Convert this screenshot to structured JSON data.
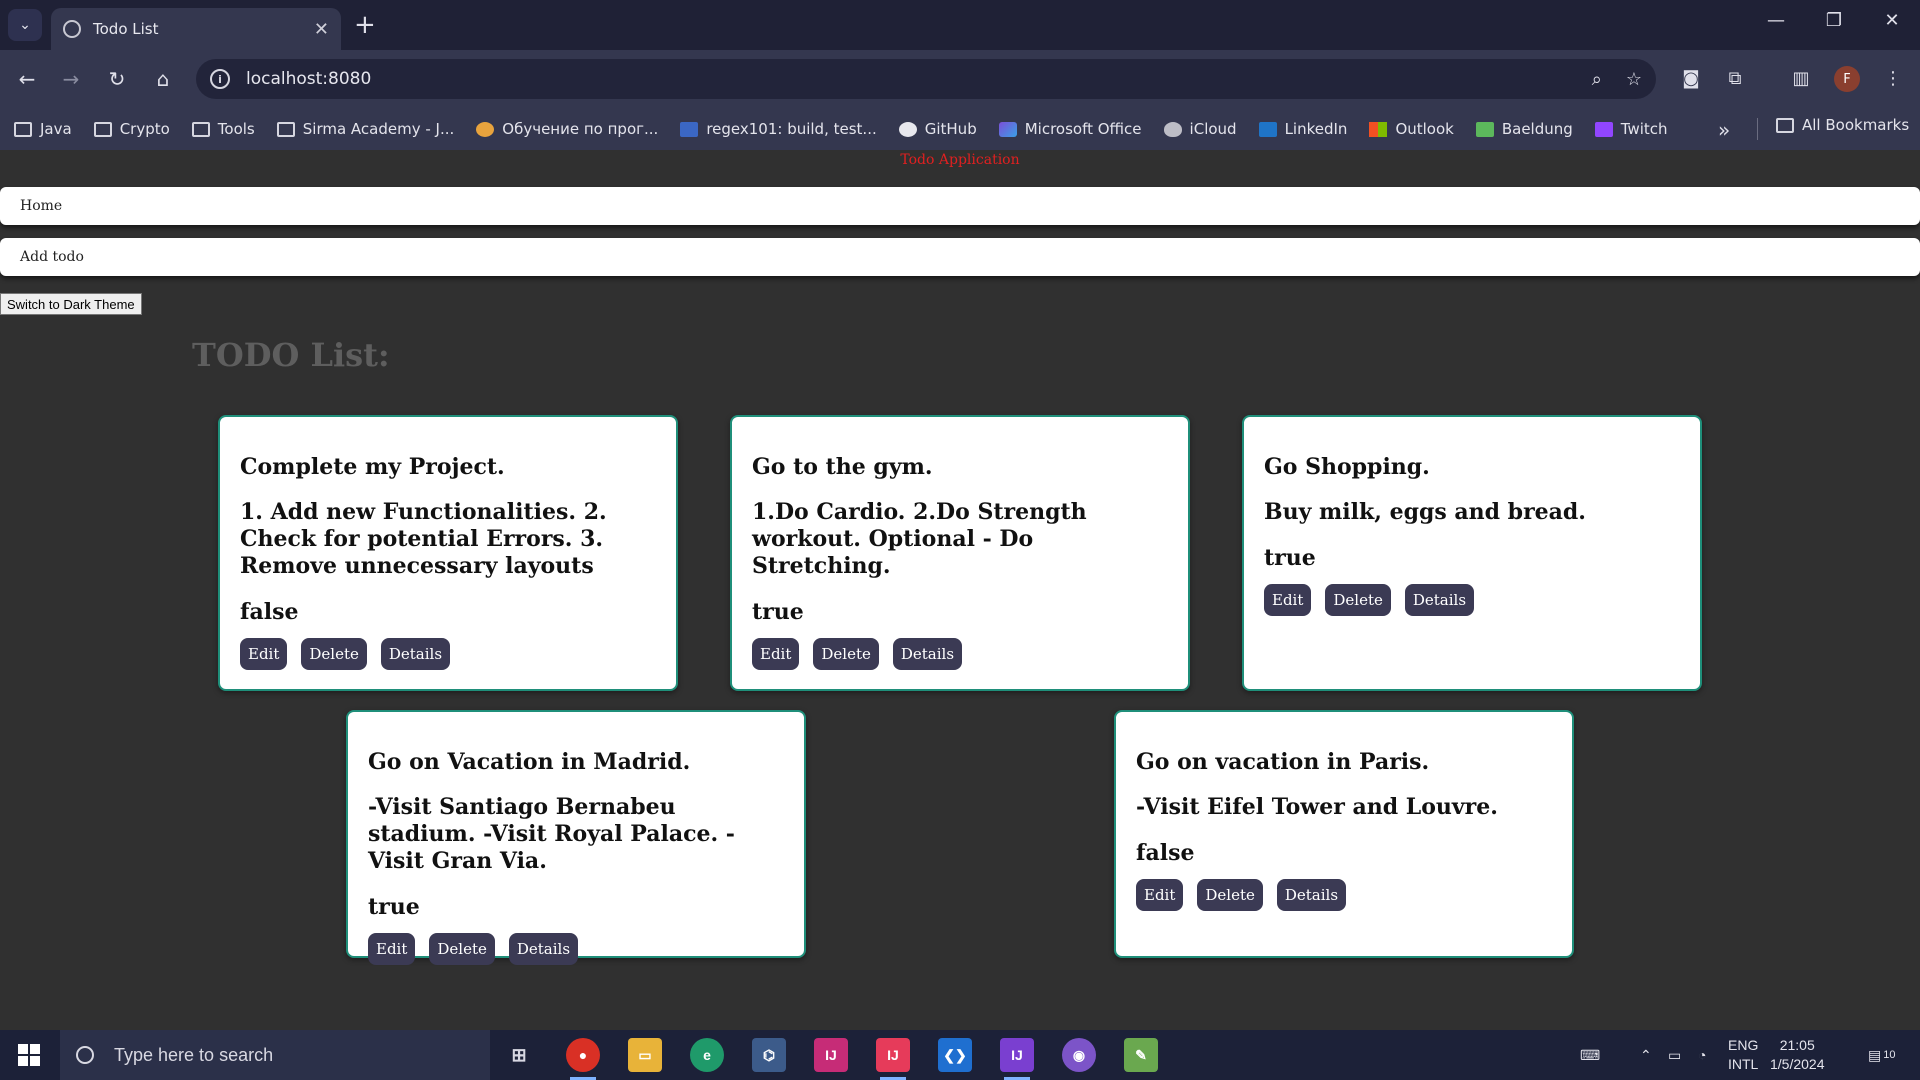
{
  "browser": {
    "tab_title": "Todo List",
    "url": "localhost:8080",
    "profile_initial": "F",
    "bookmarks": [
      {
        "label": "Java",
        "icon": "folder-icon"
      },
      {
        "label": "Crypto",
        "icon": "folder-icon"
      },
      {
        "label": "Tools",
        "icon": "folder-icon"
      },
      {
        "label": "Sirma Academy - J...",
        "icon": "folder-icon"
      },
      {
        "label": "Обучение по прог...",
        "icon": "softuni-icon"
      },
      {
        "label": "regex101: build, test...",
        "icon": "regex101-icon"
      },
      {
        "label": "GitHub",
        "icon": "github-icon"
      },
      {
        "label": "Microsoft Office",
        "icon": "office-icon"
      },
      {
        "label": "iCloud",
        "icon": "apple-icon"
      },
      {
        "label": "LinkedIn",
        "icon": "linkedin-icon"
      },
      {
        "label": "Outlook",
        "icon": "microsoft-icon"
      },
      {
        "label": "Baeldung",
        "icon": "baeldung-icon"
      },
      {
        "label": "Twitch",
        "icon": "twitch-icon"
      }
    ],
    "all_bookmarks_label": "All Bookmarks"
  },
  "page": {
    "app_title": "Todo Application",
    "nav": {
      "home": "Home",
      "add_todo": "Add todo"
    },
    "theme_button": "Switch to Dark Theme",
    "list_title": "TODO List:",
    "todos": [
      {
        "title": "Complete my Project.",
        "description": "1. Add new Functionalities. 2. Check for potential Errors. 3. Remove unnecessary layouts",
        "status": "false"
      },
      {
        "title": "Go to the gym.",
        "description": "1.Do Cardio. 2.Do Strength workout. Optional - Do Stretching.",
        "status": "true"
      },
      {
        "title": "Go Shopping.",
        "description": "Buy milk, eggs and bread.",
        "status": "true"
      },
      {
        "title": "Go on Vacation in Madrid.",
        "description": "-Visit Santiago Bernabeu stadium. -Visit Royal Palace. -Visit Gran Via.",
        "status": "true"
      },
      {
        "title": "Go on vacation in Paris.",
        "description": "-Visit Eifel Tower and Louvre.",
        "status": "false"
      }
    ],
    "buttons": {
      "edit": "Edit",
      "delete": "Delete",
      "details": "Details"
    }
  },
  "taskbar": {
    "search_placeholder": "Type here to search",
    "lang_line1": "ENG",
    "lang_line2": "INTL",
    "time": "21:05",
    "date": "1/5/2024",
    "notifications": "10"
  },
  "colors": {
    "accent_border": "#1f8f7a",
    "button_bg": "#3b3a54",
    "app_title": "#e02020"
  }
}
